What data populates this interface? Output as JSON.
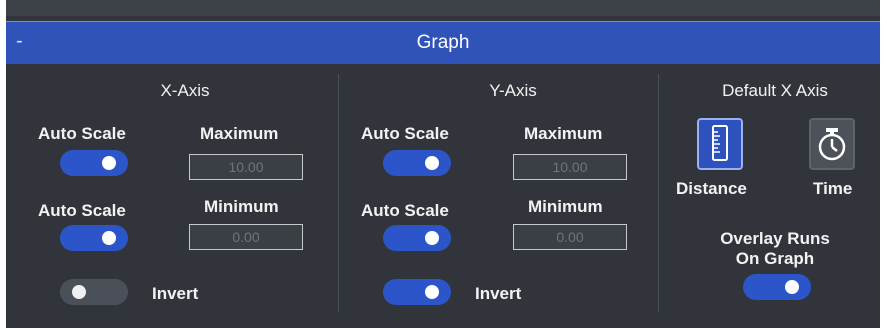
{
  "header": {
    "collapse_label": "-",
    "title": "Graph"
  },
  "x_axis": {
    "title": "X-Axis",
    "auto_scale_max_label": "Auto Scale",
    "maximum_label": "Maximum",
    "maximum_value": "10.00",
    "auto_scale_min_label": "Auto Scale",
    "minimum_label": "Minimum",
    "minimum_value": "0.00",
    "invert_label": "Invert"
  },
  "y_axis": {
    "title": "Y-Axis",
    "auto_scale_max_label": "Auto Scale",
    "maximum_label": "Maximum",
    "maximum_value": "10.00",
    "auto_scale_min_label": "Auto Scale",
    "minimum_label": "Minimum",
    "minimum_value": "0.00",
    "invert_label": "Invert"
  },
  "default_x": {
    "title": "Default X Axis",
    "distance_label": "Distance",
    "time_label": "Time",
    "overlay_label_line1": "Overlay Runs",
    "overlay_label_line2": "On Graph"
  },
  "toggles": {
    "x_auto_scale_max": true,
    "x_auto_scale_min": true,
    "x_invert": false,
    "y_auto_scale_max": true,
    "y_auto_scale_min": true,
    "y_invert": true,
    "overlay_runs": true
  },
  "colors": {
    "panel_bg": "#31353b",
    "header_bg": "#2f53b8",
    "toggle_on": "#2c55c9",
    "toggle_off": "#4b4f57"
  },
  "icons": {
    "distance": "ruler-icon",
    "time": "stopwatch-icon"
  }
}
